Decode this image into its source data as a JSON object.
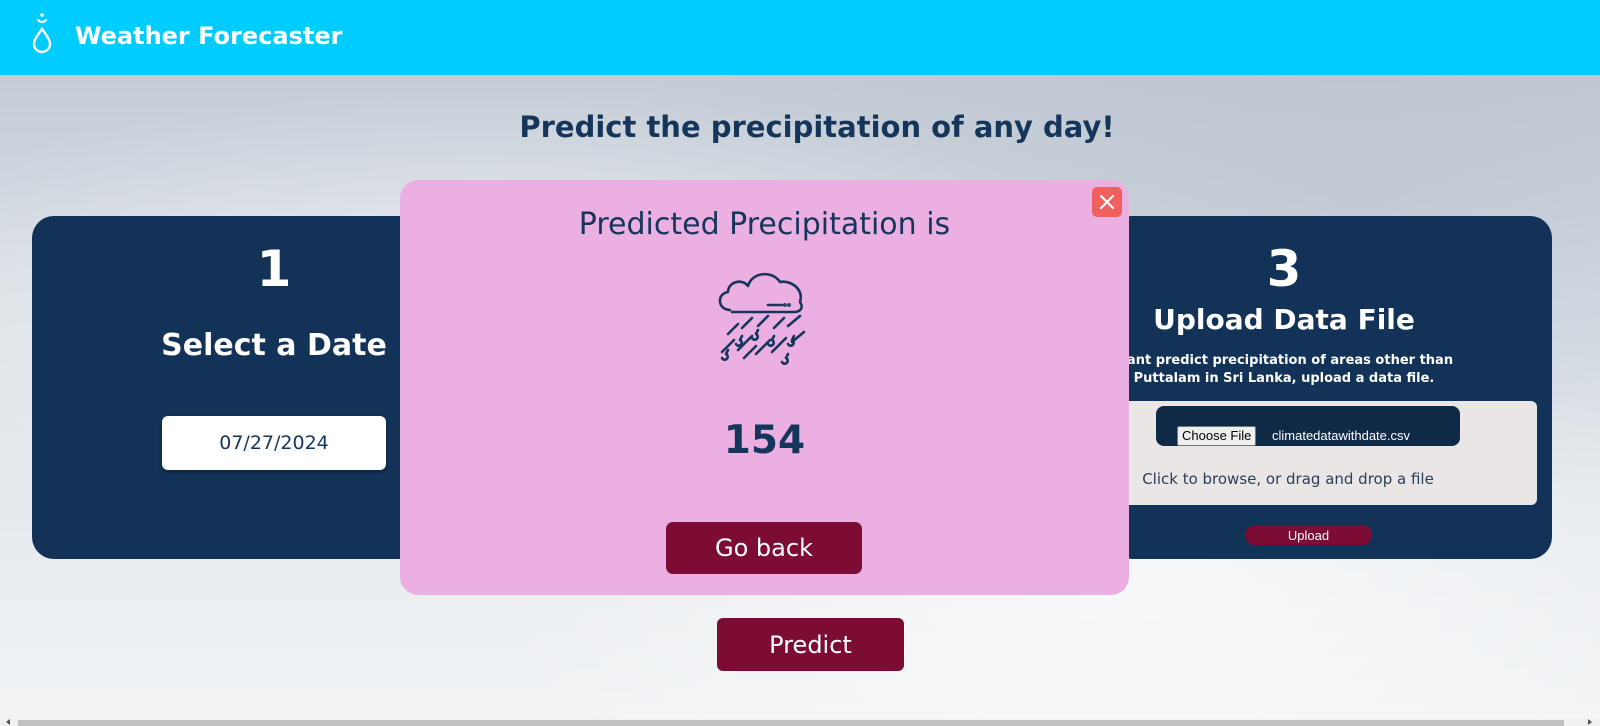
{
  "header": {
    "app_title": "Weather Forecaster",
    "logo_icon": "raindrop-logo-icon",
    "background_color": "#00ccff"
  },
  "main": {
    "heading": "Predict the precipitation of any day!"
  },
  "step1": {
    "number": "1",
    "title": "Select a Date",
    "date_value": "07/27/2024"
  },
  "step3": {
    "number": "3",
    "title": "Upload Data File",
    "description": "want predict precipitation of areas other than Puttalam in Sri Lanka, upload a data file.",
    "choose_file_label": "Choose File",
    "file_name": "climatedatawithdate.csv",
    "drop_hint": "Click to browse, or drag and drop a file",
    "upload_label": "Upload"
  },
  "predict_label": "Predict",
  "modal": {
    "title": "Predicted Precipitation is",
    "icon": "rain-cloud-icon",
    "value": "154",
    "go_back_label": "Go back",
    "close_icon": "close-icon",
    "background_color": "#ebafe2"
  },
  "colors": {
    "card_bg": "#123257",
    "button_bg": "#7d0c34",
    "heading_text": "#15365a",
    "close_bg": "#f25f5f"
  }
}
